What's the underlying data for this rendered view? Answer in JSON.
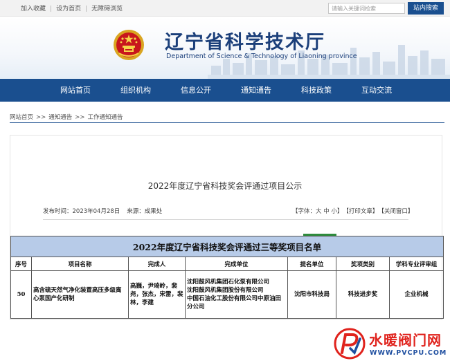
{
  "topbar": {
    "links": [
      "加入收藏",
      "设为首页",
      "无障碍浏览"
    ],
    "search_placeholder": "请输入关键词检索",
    "search_button": "站内搜索"
  },
  "header": {
    "title": "辽宁省科学技术厅",
    "subtitle": "Department of Science & Technology of Liaoning province"
  },
  "nav": {
    "items": [
      "网站首页",
      "组织机构",
      "信息公开",
      "通知通告",
      "科技政策",
      "互动交流"
    ]
  },
  "breadcrumb": {
    "items": [
      "网站首页",
      "通知通告",
      "工作通知通告"
    ],
    "separator": ">>"
  },
  "article": {
    "title": "2022年度辽宁省科技奖会评通过项目公示",
    "publish_time": "发布时间：2023年04月28日",
    "source": "来源：成果处",
    "tools": [
      "【字体：大 中 小】",
      "【打印文章】",
      "【关闭窗口】"
    ]
  },
  "table": {
    "caption": "2022年度辽宁省科技奖会评通过三等奖项目名单",
    "headers": [
      "序号",
      "项目名称",
      "完成人",
      "完成单位",
      "提名单位",
      "奖项类别",
      "学科专业评审组"
    ],
    "rows": [
      {
        "no": "50",
        "project": "高含硫天然气净化装置高压多级离心泵国产化研制",
        "people": "高巍，尹琦岭，裴尧，张杰，宋雷，裴林，李建",
        "units": [
          "沈阳鼓风机集团石化泵有限公司",
          "沈阳鼓风机集团股份有限公司",
          "中国石油化工股份有限公司中原油田分公司"
        ],
        "nominator": "沈阳市科技局",
        "category": "科技进步奖",
        "group": "企业机械"
      }
    ]
  },
  "watermark": {
    "name": "水暖阀门网",
    "url": "WWW.PVCPU.COM"
  },
  "colors": {
    "nav_blue": "#1a4f8f",
    "title_blue": "#1b3f7a",
    "table_caption_bg": "#b7cbe8",
    "watermark_red": "#e0231d"
  }
}
